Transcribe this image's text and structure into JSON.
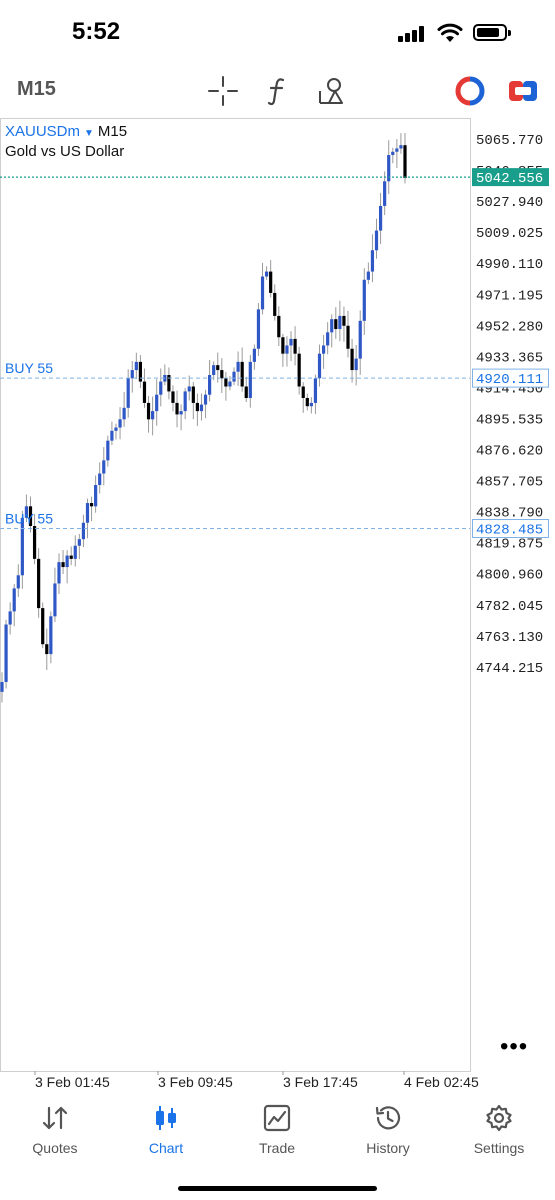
{
  "status_bar": {
    "time": "5:52"
  },
  "toolbar": {
    "timeframe": "M15",
    "icons": [
      "crosshair-icon",
      "function-icon",
      "objects-icon",
      "one-click-trading-icon",
      "trade-panel-icon"
    ]
  },
  "chart": {
    "symbol": "XAUUSDm",
    "timeframe": "M15",
    "description": "Gold vs US Dollar",
    "current_price": "5042.556",
    "more_label": "•••"
  },
  "orders": [
    {
      "label": "BUY 55",
      "price": "4920.111"
    },
    {
      "label": "BUY 55",
      "price": "4828.485"
    }
  ],
  "tabs": [
    {
      "label": "Quotes",
      "active": false
    },
    {
      "label": "Chart",
      "active": true
    },
    {
      "label": "Trade",
      "active": false
    },
    {
      "label": "History",
      "active": false
    },
    {
      "label": "Settings",
      "active": false
    }
  ],
  "colors": {
    "accent": "#1a73e8",
    "bull_candle": "#2f57c6",
    "bear_candle": "#000000",
    "bid_line": "#1a9e8c",
    "order_line": "#7fb2e8"
  },
  "chart_data": {
    "type": "candlestick",
    "symbol": "XAUUSDm",
    "timeframe": "M15",
    "title": "Gold vs US Dollar",
    "y_ticks": [
      "5065.770",
      "5046.855",
      "5027.940",
      "5009.025",
      "4990.110",
      "4971.195",
      "4952.280",
      "4933.365",
      "4914.450",
      "4895.535",
      "4876.620",
      "4857.705",
      "4838.790",
      "4819.875",
      "4800.960",
      "4782.045",
      "4763.130",
      "4744.215"
    ],
    "x_ticks": [
      "3 Feb 01:45",
      "3 Feb 09:45",
      "3 Feb 17:45",
      "4 Feb 02:45"
    ],
    "ylim": [
      4735,
      5079
    ],
    "current_price": 5042.556,
    "close_series_approx": [
      4735,
      4770,
      4778,
      4792,
      4800,
      4835,
      4842,
      4830,
      4810,
      4780,
      4758,
      4752,
      4775,
      4795,
      4808,
      4805,
      4812,
      4810,
      4818,
      4822,
      4832,
      4844,
      4842,
      4855,
      4862,
      4870,
      4882,
      4888,
      4890,
      4895,
      4902,
      4920,
      4925,
      4930,
      4918,
      4905,
      4895,
      4900,
      4910,
      4918,
      4922,
      4912,
      4905,
      4898,
      4900,
      4912,
      4915,
      4905,
      4900,
      4904,
      4910,
      4922,
      4928,
      4925,
      4920,
      4915,
      4918,
      4924,
      4930,
      4915,
      4908,
      4930,
      4938,
      4962,
      4982,
      4985,
      4972,
      4958,
      4945,
      4935,
      4940,
      4944,
      4935,
      4915,
      4908,
      4903,
      4905,
      4920,
      4935,
      4940,
      4948,
      4956,
      4950,
      4958,
      4952,
      4938,
      4925,
      4932,
      4955,
      4980,
      4985,
      4998,
      5010,
      5025,
      5040,
      5056,
      5058,
      5060,
      5062,
      5042
    ]
  }
}
